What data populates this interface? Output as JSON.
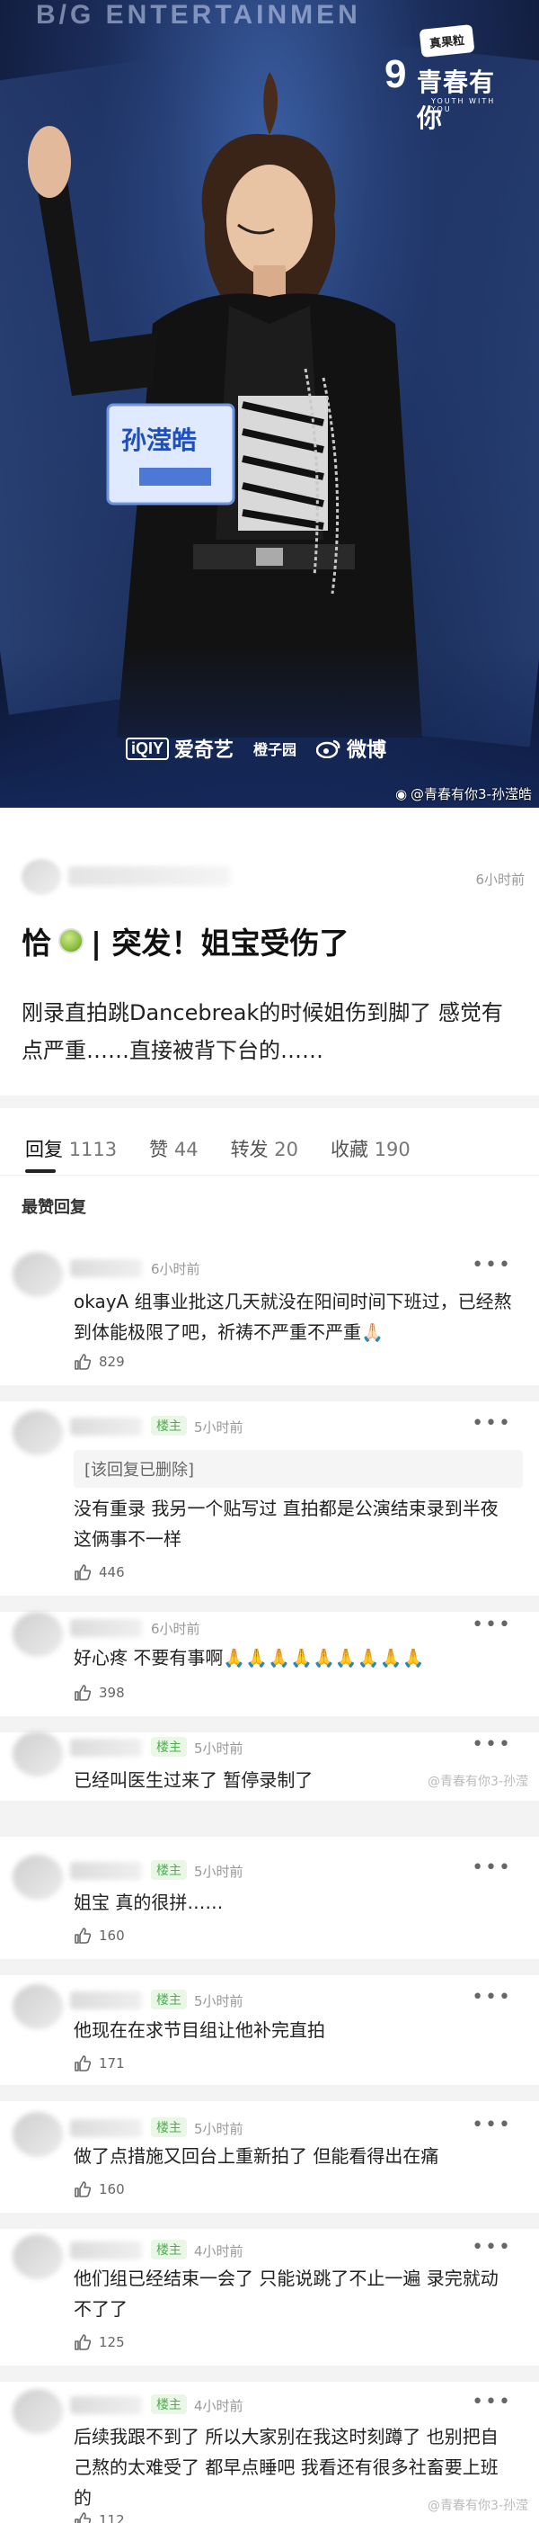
{
  "photo": {
    "bg_text": "B/G ENTERTAINMEN",
    "show_logo": {
      "bubble": "真果粒",
      "number": "9",
      "name": "青春有你",
      "subtitle": "YOUTH WITH YOU"
    },
    "sponsors": {
      "iqiyi_mark": "iQIY",
      "iqiyi_name": "爱奇艺",
      "second_name": "橙子园",
      "weibo_name": "微博"
    },
    "watermark": "@青春有你3-孙滢皓",
    "badge_name": "孙滢皓"
  },
  "post": {
    "time": "6小时前",
    "title_prefix": "恰",
    "title_rest": "| 突发！姐宝受伤了",
    "body": "刚录直拍跳Dancebreak的时候姐伤到脚了 感觉有点严重……直接被背下台的……"
  },
  "tabs": [
    {
      "label": "回复",
      "count": "1113"
    },
    {
      "label": "赞",
      "count": "44"
    },
    {
      "label": "转发",
      "count": "20"
    },
    {
      "label": "收藏",
      "count": "190"
    }
  ],
  "hot_label": "最赞回复",
  "comments": [
    {
      "badge": "",
      "time": "6小时前",
      "text": "okayA 组事业批这几天就没在阳间时间下班过，已经熬到体能极限了吧，祈祷不严重不严重🙏🏻",
      "likes": "829"
    },
    {
      "badge": "楼主",
      "time": "5小时前",
      "deleted": "[该回复已删除]",
      "text": "没有重录 我另一个贴写过 直拍都是公演结束录到半夜 这俩事不一样",
      "likes": "446"
    },
    {
      "badge": "",
      "time": "6小时前",
      "text": "好心疼 不要有事啊🙏🙏🙏🙏🙏🙏🙏🙏🙏",
      "likes": "398"
    },
    {
      "badge": "楼主",
      "time": "5小时前",
      "text": "已经叫医生过来了 暂停录制了",
      "likes": ""
    },
    {
      "badge": "楼主",
      "time": "5小时前",
      "text": "姐宝 真的很拼……",
      "likes": "160"
    },
    {
      "badge": "楼主",
      "time": "5小时前",
      "text": "他现在在求节目组让他补完直拍",
      "likes": "171"
    },
    {
      "badge": "楼主",
      "time": "5小时前",
      "text": "做了点措施又回台上重新拍了 但能看得出在痛",
      "likes": "160"
    },
    {
      "badge": "楼主",
      "time": "4小时前",
      "text": "他们组已经结束一会了 只能说跳了不止一遍 录完就动不了了",
      "likes": "125"
    },
    {
      "badge": "楼主",
      "time": "4小时前",
      "text": "后续我跟不到了 所以大家别在我这时刻蹲了 也别把自己熬的太难受了 都早点睡吧 我看还有很多社畜要上班的",
      "likes": "112"
    }
  ],
  "small_watermarks": [
    "@青春有你3-孙滢",
    "@青春有你3-孙滢"
  ],
  "colors": {
    "accent": "#4caf50",
    "divider": "#f4f4f4"
  }
}
